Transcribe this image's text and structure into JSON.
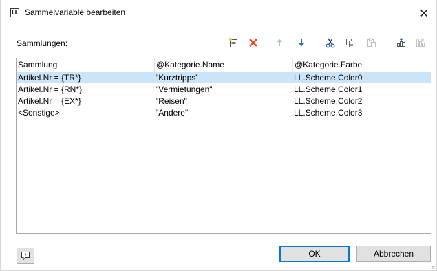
{
  "window": {
    "app_icon_text": "LL",
    "title": "Sammelvariable bearbeiten",
    "close_icon": "close-icon"
  },
  "label": {
    "mnemonic": "S",
    "rest": "ammlungen:"
  },
  "toolbar": {
    "icons": [
      "new-item-icon",
      "delete-icon",
      "move-up-icon",
      "move-down-icon",
      "cut-icon",
      "copy-icon",
      "paste-icon",
      "insert-column-icon",
      "remove-column-icon"
    ],
    "colors": {
      "delete": "#e8461e",
      "arrow_active": "#2b6cc4",
      "arrow_disabled": "#a9bfe0",
      "accent": "#0078d7"
    }
  },
  "table": {
    "columns": [
      "Sammlung",
      "@Kategorie.Name",
      "@Kategorie.Farbe"
    ],
    "rows": [
      [
        "Artikel.Nr = {TR*}",
        "\"Kurztripps\"",
        "LL.Scheme.Color0"
      ],
      [
        "Artikel.Nr = {RN*}",
        "\"Vermietungen\"",
        "LL.Scheme.Color1"
      ],
      [
        "Artikel.Nr = {EX*}",
        "\"Reisen\"",
        "LL.Scheme.Color2"
      ],
      [
        "<Sonstige>",
        "\"Andere\"",
        "LL.Scheme.Color3"
      ]
    ],
    "selected_row": 0,
    "selection_color": "#cce4f7"
  },
  "buttons": {
    "help_icon": "help-icon",
    "ok": "OK",
    "cancel": "Abbrechen"
  }
}
